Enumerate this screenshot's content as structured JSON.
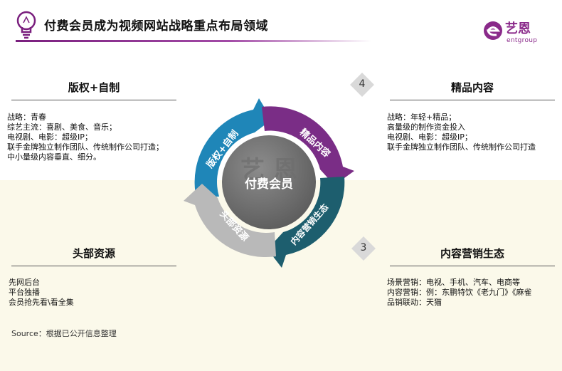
{
  "header": {
    "title": "付费会员成为视频网站战略重点布局领域",
    "logo_text": "艺恩",
    "logo_sub": "entgroup"
  },
  "cycle": {
    "center_label": "付费会员",
    "watermark": "艺 恩",
    "segments": [
      {
        "label": "版权+自制",
        "color": "#1f86b8"
      },
      {
        "label": "精品内容",
        "color": "#7a2d86"
      },
      {
        "label": "内容营销生态",
        "color": "#1d5e6e"
      },
      {
        "label": "头部资源",
        "color": "#b9b9b9"
      }
    ]
  },
  "markers": {
    "top": "4",
    "bottom": "3"
  },
  "sections": {
    "top_left": {
      "title": "版权+自制",
      "lines": [
        "战略：青春",
        "综艺主流：喜剧、美食、音乐；",
        "电视剧、电影：超级IP；",
        "联手金牌独立制作团队、传统制作公司打造；",
        "中小量级内容垂直、细分。"
      ]
    },
    "top_right": {
      "title": "精品内容",
      "lines": [
        "战略：年轻+精品；",
        "高量级的制作资金投入",
        "电视剧、电影：超级IP；",
        "联手金牌独立制作团队、传统制作公司打造"
      ]
    },
    "bottom_left": {
      "title": "头部资源",
      "lines": [
        "先网后台",
        "平台独播",
        "会员抢先看\\看全集"
      ]
    },
    "bottom_right": {
      "title": "内容营销生态",
      "lines": [
        "场景营销：电视、手机、汽车、电商等",
        "内容营销：例：东鹏特饮《老九门》《麻雀",
        "品销联动：天猫"
      ]
    }
  },
  "source": "Source：根据已公开信息整理"
}
